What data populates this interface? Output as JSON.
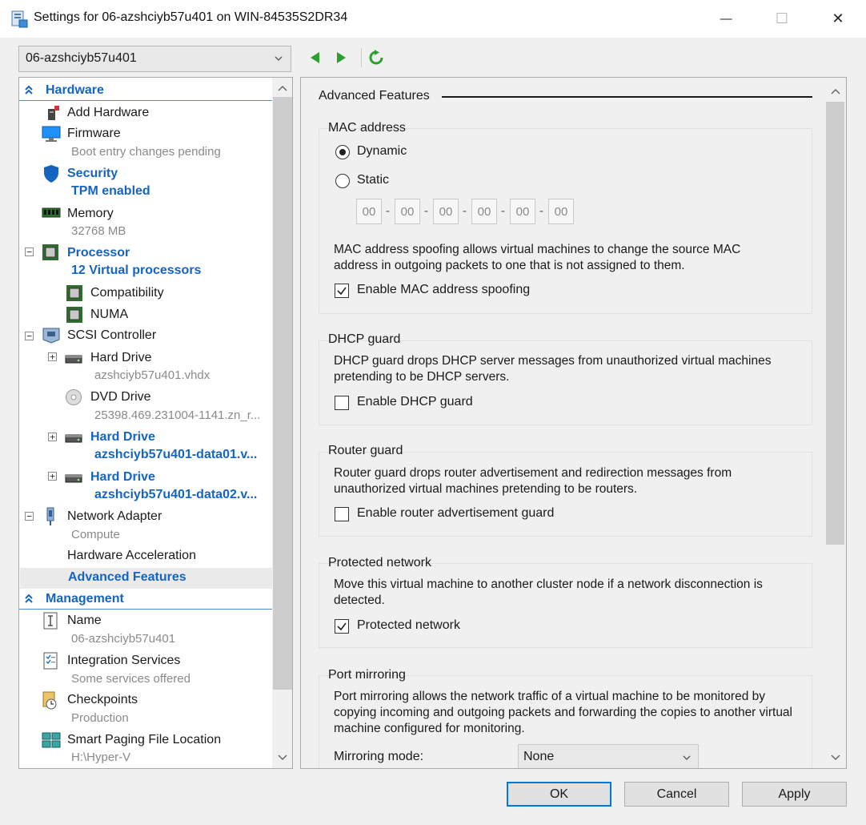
{
  "window": {
    "title": "Settings for 06-azshciyb57u401 on WIN-84535S2DR34",
    "minimize_glyph": "—",
    "maximize_glyph": "☐",
    "close_glyph": "✕"
  },
  "vm_selector": {
    "value": "06-azshciyb57u401"
  },
  "tree": {
    "hardware_header": "Hardware",
    "management_header": "Management",
    "items": {
      "add_hardware": {
        "label": "Add Hardware",
        "icon": "add-hardware-icon"
      },
      "firmware": {
        "label": "Firmware",
        "sub": "Boot entry changes pending",
        "icon": "firmware-icon"
      },
      "security": {
        "label": "Security",
        "sub": "TPM enabled",
        "icon": "shield-icon"
      },
      "memory": {
        "label": "Memory",
        "sub": "32768 MB",
        "icon": "memory-icon"
      },
      "processor": {
        "label": "Processor",
        "sub": "12 Virtual processors",
        "icon": "processor-icon"
      },
      "compatibility": {
        "label": "Compatibility",
        "icon": "processor-icon"
      },
      "numa": {
        "label": "NUMA",
        "icon": "processor-icon"
      },
      "scsi": {
        "label": "SCSI Controller",
        "icon": "scsi-icon"
      },
      "hard_drive_1": {
        "label": "Hard Drive",
        "sub": "azshciyb57u401.vhdx",
        "icon": "hard-drive-icon"
      },
      "dvd_drive": {
        "label": "DVD Drive",
        "sub": "25398.469.231004-1141.zn_r...",
        "icon": "dvd-icon"
      },
      "hard_drive_2": {
        "label": "Hard Drive",
        "sub": "azshciyb57u401-data01.v...",
        "icon": "hard-drive-icon"
      },
      "hard_drive_3": {
        "label": "Hard Drive",
        "sub": "azshciyb57u401-data02.v...",
        "icon": "hard-drive-icon"
      },
      "network_adapter": {
        "label": "Network Adapter",
        "sub": "Compute",
        "icon": "network-adapter-icon"
      },
      "hw_accel": {
        "label": "Hardware Acceleration"
      },
      "adv_features": {
        "label": "Advanced Features"
      },
      "name": {
        "label": "Name",
        "sub": "06-azshciyb57u401",
        "icon": "name-icon"
      },
      "integration": {
        "label": "Integration Services",
        "sub": "Some services offered",
        "icon": "integration-icon"
      },
      "checkpoints": {
        "label": "Checkpoints",
        "sub": "Production",
        "icon": "checkpoints-icon"
      },
      "smart_paging": {
        "label": "Smart Paging File Location",
        "sub": "H:\\Hyper-V",
        "icon": "smart-paging-icon"
      }
    }
  },
  "advanced": {
    "title": "Advanced Features",
    "mac": {
      "title": "MAC address",
      "dynamic_label": "Dynamic",
      "static_label": "Static",
      "selected": "Dynamic",
      "octets": [
        "00",
        "00",
        "00",
        "00",
        "00",
        "00"
      ],
      "dash": "-",
      "spoof_desc": "MAC address spoofing allows virtual machines to change the source MAC address in outgoing packets to one that is not assigned to them.",
      "spoof_label": "Enable MAC address spoofing",
      "spoof_checked": true
    },
    "dhcp": {
      "title": "DHCP guard",
      "desc": "DHCP guard drops DHCP server messages from unauthorized virtual machines pretending to be DHCP servers.",
      "label": "Enable DHCP guard",
      "checked": false
    },
    "router": {
      "title": "Router guard",
      "desc": "Router guard drops router advertisement and redirection messages from unauthorized virtual machines pretending to be routers.",
      "label": "Enable router advertisement guard",
      "checked": false
    },
    "protected": {
      "title": "Protected network",
      "desc": "Move this virtual machine to another cluster node if a network disconnection is detected.",
      "label": "Protected network",
      "checked": true
    },
    "mirroring": {
      "title": "Port mirroring",
      "desc": "Port mirroring allows the network traffic of a virtual machine to be monitored by copying incoming and outgoing packets and forwarding the copies to another virtual machine configured for monitoring.",
      "mode_label": "Mirroring mode:",
      "mode_value": "None"
    }
  },
  "buttons": {
    "ok": "OK",
    "cancel": "Cancel",
    "apply": "Apply"
  },
  "colors": {
    "accent": "#1565c0",
    "nav_green": "#2e9e2e",
    "focus_border": "#0078d7"
  }
}
